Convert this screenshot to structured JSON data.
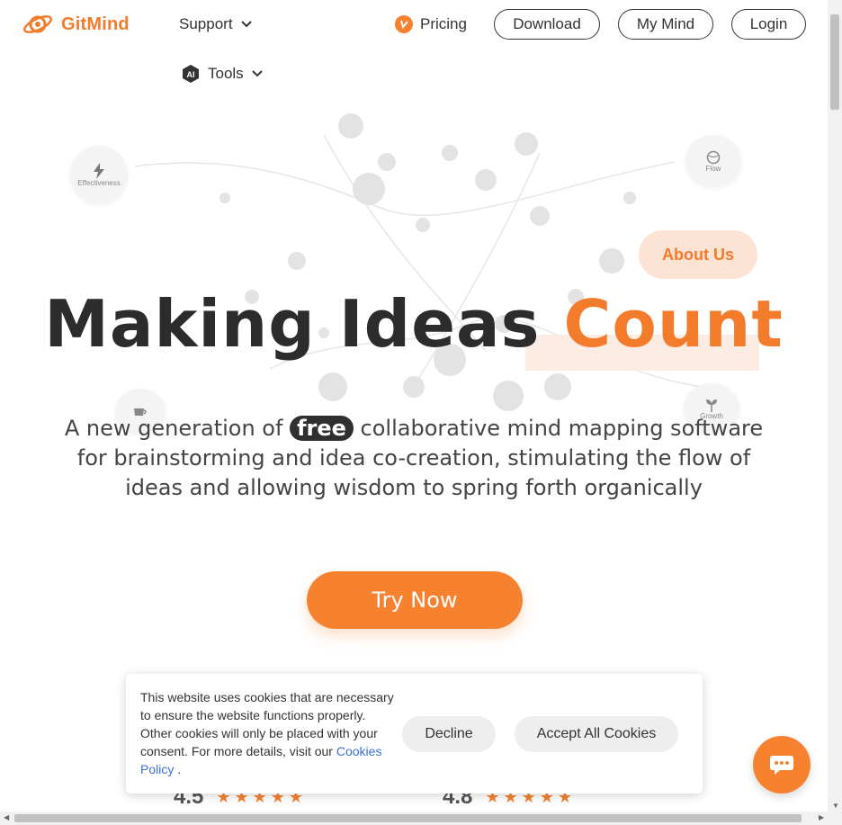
{
  "header": {
    "logo_text": "GitMind",
    "nav": {
      "support": "Support",
      "tools": "Tools",
      "pricing": "Pricing",
      "download": "Download",
      "my_mind": "My Mind",
      "login": "Login"
    },
    "ai_badge": "AI"
  },
  "hero": {
    "floating_tags": {
      "effectiveness": "Effectiveness",
      "flow": "Flow",
      "growth": "Growth"
    },
    "about_us": "About Us",
    "headline_main": "Making Ideas",
    "headline_accent": "Count",
    "subtitle_part1": "A new generation of ",
    "subtitle_free": "free",
    "subtitle_part2": " collaborative mind mapping software for brainstorming and idea co-creation, stimulating the flow of ideas and allowing wisdom to spring forth organically",
    "cta": "Try Now"
  },
  "ratings": [
    {
      "value": "4.5",
      "stars": "★★★★★"
    },
    {
      "value": "4.8",
      "stars": "★★★★★"
    }
  ],
  "cookie_banner": {
    "text": "This website uses cookies that are necessary to ensure the website functions properly. Other cookies will only be placed with your consent. For more details, visit our ",
    "link": "Cookies Policy",
    "after_link": " .",
    "decline": "Decline",
    "accept": "Accept All Cookies"
  },
  "colors": {
    "accent": "#f27b2c",
    "button_orange": "#f6822f",
    "dark_text": "#2c2c2c"
  },
  "icons": [
    "gitmind-logo-icon",
    "chevron-down-icon",
    "ai-icon",
    "pricing-icon",
    "bolt-icon",
    "globe-icon",
    "cup-icon",
    "sprout-icon",
    "chat-icon"
  ]
}
